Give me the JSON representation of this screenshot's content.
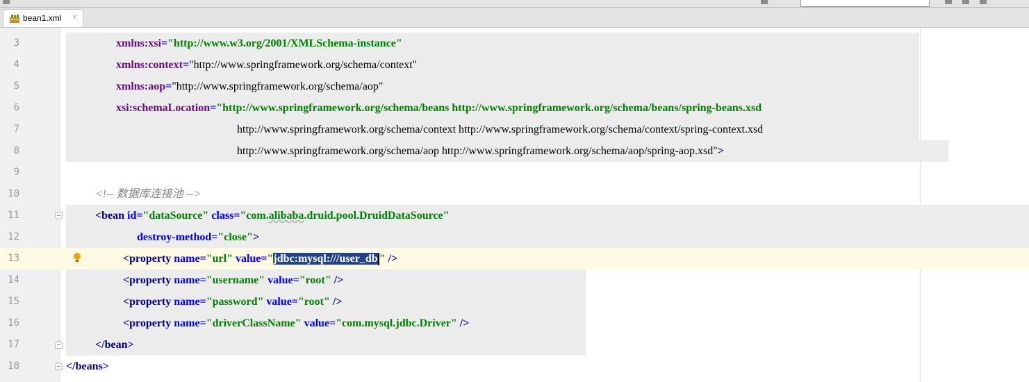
{
  "tab": {
    "file_name": "bean1.xml",
    "close_glyph": "×",
    "icon": "xml-file-icon"
  },
  "editor": {
    "lines": [
      {
        "n": "3",
        "indent": 167,
        "hl": [
          95,
          1323
        ],
        "tokens": [
          [
            "ns",
            "xmlns:xsi"
          ],
          [
            "a",
            "="
          ],
          [
            "v",
            "\"http://www.w3.org/2001/XMLSchema-instance\""
          ]
        ]
      },
      {
        "n": "4",
        "indent": 167,
        "hl": [
          95,
          1323
        ],
        "tokens": [
          [
            "ns",
            "xmlns:context"
          ],
          [
            "a",
            "="
          ],
          [
            "url",
            "\"http://www.springframework.org/schema/context\""
          ]
        ]
      },
      {
        "n": "5",
        "indent": 167,
        "hl": [
          95,
          1323
        ],
        "tokens": [
          [
            "ns",
            "xmlns:aop"
          ],
          [
            "a",
            "="
          ],
          [
            "url",
            "\"http://www.springframework.org/schema/aop\""
          ]
        ]
      },
      {
        "n": "6",
        "indent": 167,
        "hl": [
          95,
          1323
        ],
        "tokens": [
          [
            "ns",
            "xsi:schemaLocation"
          ],
          [
            "a",
            "="
          ],
          [
            "v",
            "\"http://www.springframework.org/schema/beans http://www.springframework.org/schema/beans/spring-beans.xsd"
          ]
        ]
      },
      {
        "n": "7",
        "indent": 341,
        "hl": [
          95,
          1323
        ],
        "tokens": [
          [
            "url",
            "http://www.springframework.org/schema/context http://www.springframework.org/schema/context/spring-context.xsd"
          ]
        ]
      },
      {
        "n": "8",
        "indent": 341,
        "hl": [
          95,
          1365
        ],
        "tokens": [
          [
            "url",
            "http://www.springframework.org/schema/aop http://www.springframework.org/schema/aop/spring-aop.xsd\""
          ],
          [
            "t",
            ">"
          ]
        ]
      },
      {
        "n": "9",
        "indent": 0,
        "tokens": []
      },
      {
        "n": "10",
        "indent": 137,
        "tokens": [
          [
            "c",
            "<!-- 数据库连接池 -->"
          ]
        ]
      },
      {
        "n": "11",
        "indent": 137,
        "hl": [
          95,
          1481
        ],
        "fold": "open",
        "tokens": [
          [
            "t",
            "<bean "
          ],
          [
            "a",
            "id"
          ],
          [
            "a",
            "="
          ],
          [
            "v",
            "\"dataSource\""
          ],
          [
            "t",
            " "
          ],
          [
            "a",
            "class"
          ],
          [
            "a",
            "="
          ],
          [
            "v",
            "\"com."
          ],
          [
            "v",
            "alibaba",
            "squig"
          ],
          [
            "v",
            ".druid.pool.DruidDataSource\""
          ]
        ]
      },
      {
        "n": "12",
        "indent": 197,
        "hl": [
          95,
          1481
        ],
        "tokens": [
          [
            "a",
            "destroy-method"
          ],
          [
            "a",
            "="
          ],
          [
            "v",
            "\"close\""
          ],
          [
            "t",
            ">"
          ]
        ]
      },
      {
        "n": "13",
        "indent": 177,
        "current": true,
        "bulb": true,
        "tokens": [
          [
            "t",
            "<property "
          ],
          [
            "a",
            "name"
          ],
          [
            "a",
            "="
          ],
          [
            "v",
            "\"url\""
          ],
          [
            "t",
            " "
          ],
          [
            "a",
            "value"
          ],
          [
            "a",
            "="
          ],
          [
            "v",
            "\""
          ],
          [
            "sel",
            "jdbc:mysql:///user_db"
          ],
          [
            "cursor",
            ""
          ],
          [
            "v",
            "\""
          ],
          [
            "t",
            " />"
          ]
        ]
      },
      {
        "n": "14",
        "indent": 177,
        "hl": [
          95,
          843
        ],
        "tokens": [
          [
            "t",
            "<property "
          ],
          [
            "a",
            "name"
          ],
          [
            "a",
            "="
          ],
          [
            "v",
            "\"username\""
          ],
          [
            "t",
            " "
          ],
          [
            "a",
            "value"
          ],
          [
            "a",
            "="
          ],
          [
            "v",
            "\"root\""
          ],
          [
            "t",
            " />"
          ]
        ]
      },
      {
        "n": "15",
        "indent": 177,
        "hl": [
          95,
          843
        ],
        "tokens": [
          [
            "t",
            "<property "
          ],
          [
            "a",
            "name"
          ],
          [
            "a",
            "="
          ],
          [
            "v",
            "\"password\""
          ],
          [
            "t",
            " "
          ],
          [
            "a",
            "value"
          ],
          [
            "a",
            "="
          ],
          [
            "v",
            "\"root\""
          ],
          [
            "t",
            " />"
          ]
        ]
      },
      {
        "n": "16",
        "indent": 177,
        "hl": [
          95,
          843
        ],
        "tokens": [
          [
            "t",
            "<property "
          ],
          [
            "a",
            "name"
          ],
          [
            "a",
            "="
          ],
          [
            "v",
            "\"driverClassName\""
          ],
          [
            "t",
            " "
          ],
          [
            "a",
            "value"
          ],
          [
            "a",
            "="
          ],
          [
            "v",
            "\"com.mysql.jdbc.Driver\""
          ],
          [
            "t",
            " />"
          ]
        ]
      },
      {
        "n": "17",
        "indent": 137,
        "hl": [
          95,
          843
        ],
        "fold": "close",
        "tokens": [
          [
            "t",
            "</bean>"
          ]
        ]
      },
      {
        "n": "18",
        "indent": 95,
        "fold": "close",
        "tokens": [
          [
            "t",
            "</beans>"
          ]
        ]
      }
    ]
  }
}
